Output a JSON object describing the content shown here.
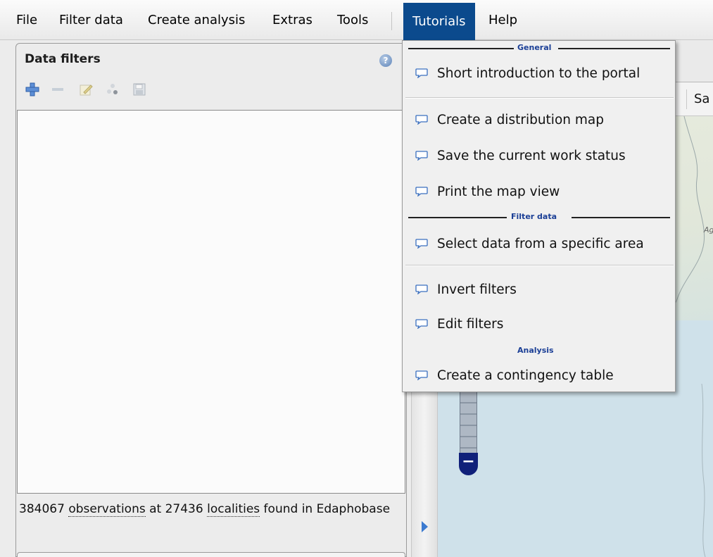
{
  "menubar": {
    "items": [
      "File",
      "Filter data",
      "Create analysis",
      "Extras",
      "Tools",
      "Tutorials",
      "Help"
    ],
    "active": "Tutorials"
  },
  "panel": {
    "title": "Data filters",
    "help_icon": "help-circle-icon",
    "toolbar": [
      "add-icon",
      "remove-icon",
      "edit-icon",
      "invert-icon",
      "save-icon"
    ],
    "status": {
      "count_observations": "384067",
      "word_observations": "observations",
      "at": " at ",
      "count_localities": "27436",
      "word_localities": "localities",
      "rest": " found in Edaphobase"
    }
  },
  "map": {
    "toolbar_text": "Sa",
    "label": "Ag"
  },
  "dropdown": {
    "groups": [
      {
        "title": "General",
        "items": [
          "Short introduction to the portal",
          "Create a distribution map",
          "Save the current work status",
          "Print the map view"
        ]
      },
      {
        "title": "Filter data",
        "items": [
          "Select data from a specific area",
          "Invert filters",
          "Edit filters"
        ]
      },
      {
        "title": "Analysis",
        "items": [
          "Create a contingency table"
        ]
      }
    ]
  },
  "colors": {
    "menu_active": "#0b4a8d",
    "group_title": "#1b3f96",
    "toolbar_add": "#3b73c7"
  }
}
